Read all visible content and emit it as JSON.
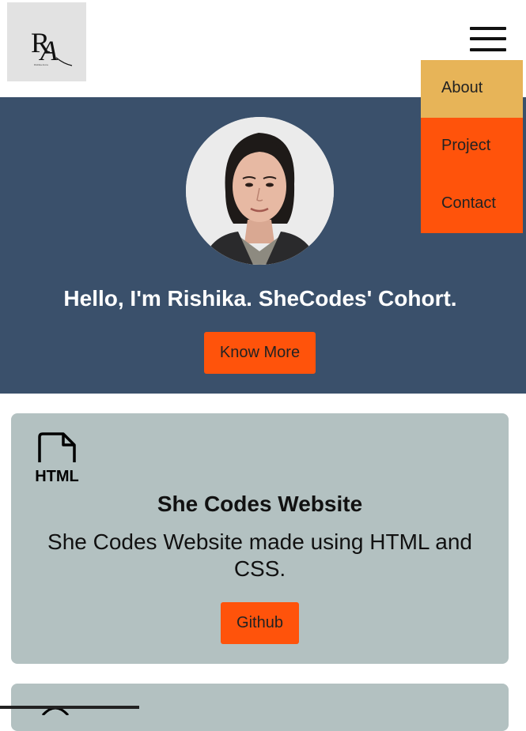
{
  "header": {
    "logo_text": "RA",
    "logo_tagline": "Rishika Arora"
  },
  "nav": {
    "items": [
      {
        "label": "About",
        "color": "#e7b458"
      },
      {
        "label": "Project",
        "color": "#ff530b"
      },
      {
        "label": "Contact",
        "color": "#ff530b"
      }
    ]
  },
  "hero": {
    "title": "Hello, I'm Rishika. SheCodes' Cohort.",
    "button_label": "Know More",
    "background": "#3a506b"
  },
  "projects": [
    {
      "icon": "html-file-icon",
      "icon_label": "HTML",
      "title": "She Codes Website",
      "description": "She Codes Website made using HTML and CSS.",
      "button_label": "Github"
    },
    {
      "icon": "project-icon"
    }
  ],
  "colors": {
    "accent": "#ff530b",
    "card": "#b3c1c1",
    "menu_highlight": "#e7b458"
  }
}
